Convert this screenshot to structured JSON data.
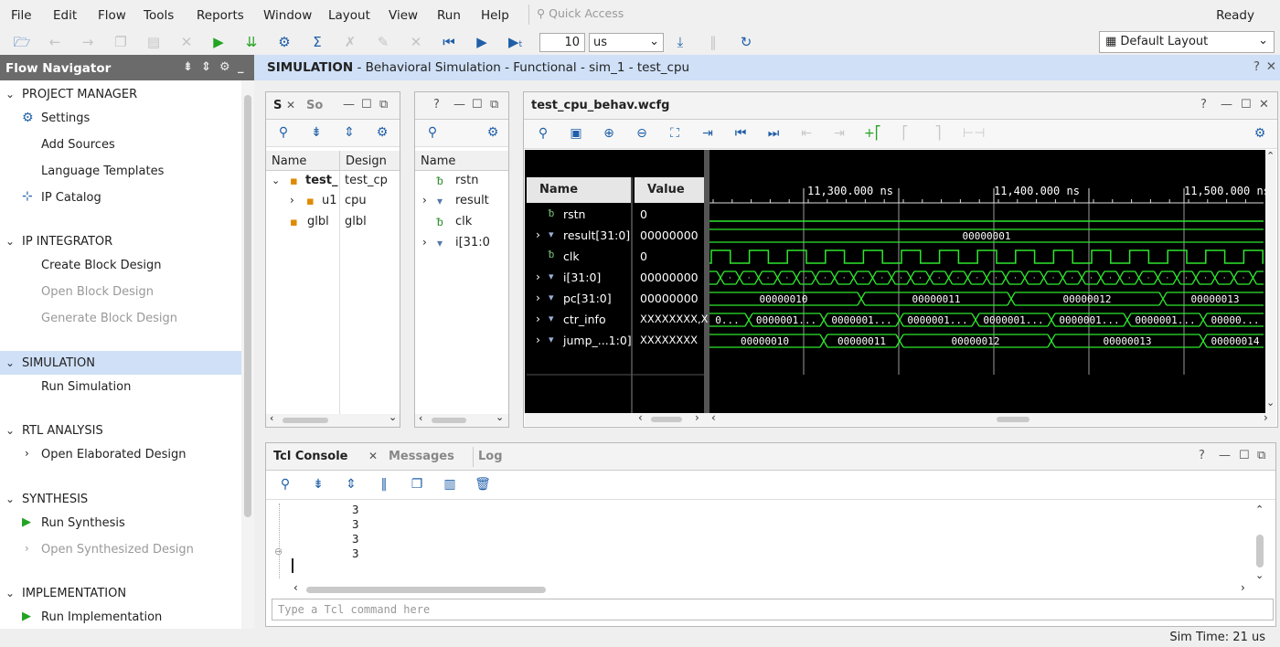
{
  "menu": [
    "File",
    "Edit",
    "Flow",
    "Tools",
    "Reports",
    "Window",
    "Layout",
    "View",
    "Run",
    "Help"
  ],
  "quick_access": "Quick Access",
  "status_ready": "Ready",
  "toolbar": {
    "run_time_value": "10",
    "run_time_unit": "us",
    "layout": "Default Layout"
  },
  "flow_navigator": {
    "title": "Flow Navigator",
    "sections": [
      {
        "label": "PROJECT MANAGER",
        "items": [
          {
            "label": "Settings",
            "icon": "gear-icon"
          },
          {
            "label": "Add Sources"
          },
          {
            "label": "Language Templates"
          },
          {
            "label": "IP Catalog",
            "icon": "ip-catalog-icon"
          }
        ]
      },
      {
        "label": "IP INTEGRATOR",
        "items": [
          {
            "label": "Create Block Design"
          },
          {
            "label": "Open Block Design"
          },
          {
            "label": "Generate Block Design"
          }
        ]
      },
      {
        "label": "SIMULATION",
        "items": [
          {
            "label": "Run Simulation"
          }
        ]
      },
      {
        "label": "RTL ANALYSIS",
        "items": [
          {
            "label": "Open Elaborated Design"
          }
        ]
      },
      {
        "label": "SYNTHESIS",
        "items": [
          {
            "label": "Run Synthesis"
          },
          {
            "label": "Open Synthesized Design"
          }
        ]
      },
      {
        "label": "IMPLEMENTATION",
        "items": [
          {
            "label": "Run Implementation"
          }
        ]
      }
    ]
  },
  "sim_title": {
    "bold": "SIMULATION",
    "rest": " - Behavioral Simulation - Functional - sim_1 - test_cpu"
  },
  "scope": {
    "tab1": "S",
    "tab2": "So",
    "col_name": "Name",
    "col_design": "Design",
    "rows": [
      {
        "name": "test_",
        "design": "test_cp"
      },
      {
        "name": "u1",
        "design": "cpu"
      },
      {
        "name": "glbl",
        "design": "glbl"
      }
    ]
  },
  "objects": {
    "tab": "?",
    "col_name": "Name",
    "rows": [
      "rstn",
      "result",
      "clk",
      "i[31:0"
    ]
  },
  "waveform": {
    "title": "test_cpu_behav.wcfg",
    "col_name": "Name",
    "col_value": "Value",
    "time_labels": [
      "11,300.000 ns",
      "11,400.000 ns",
      "11,500.000 ns"
    ],
    "signals": [
      {
        "name": "rstn",
        "value": "0"
      },
      {
        "name": "result[31:0]",
        "value": "00000000"
      },
      {
        "name": "clk",
        "value": "0"
      },
      {
        "name": "i[31:0]",
        "value": "00000000"
      },
      {
        "name": "pc[31:0]",
        "value": "00000000"
      },
      {
        "name": "ctr_info",
        "value": "XXXXXXXX,X"
      },
      {
        "name": "jump_...1:0]",
        "value": "XXXXXXXX"
      }
    ],
    "result_label": "00000001",
    "pc_labels": [
      "00000010",
      "00000011",
      "00000012",
      "00000013"
    ],
    "ctr_labels": [
      "0...",
      "0000001...",
      "0000001...",
      "0000001...",
      "0000001...",
      "0000001...",
      "0000001...",
      "00000..."
    ],
    "jump_labels": [
      "00000010",
      "00000011",
      "00000012",
      "00000013",
      "00000014"
    ],
    "i_dots": "..."
  },
  "tcl": {
    "tabs": [
      "Tcl Console",
      "Messages",
      "Log"
    ],
    "lines": [
      "3",
      "3",
      "3",
      "3"
    ],
    "placeholder": "Type a Tcl command here"
  },
  "sim_time": "Sim Time: 21 us"
}
